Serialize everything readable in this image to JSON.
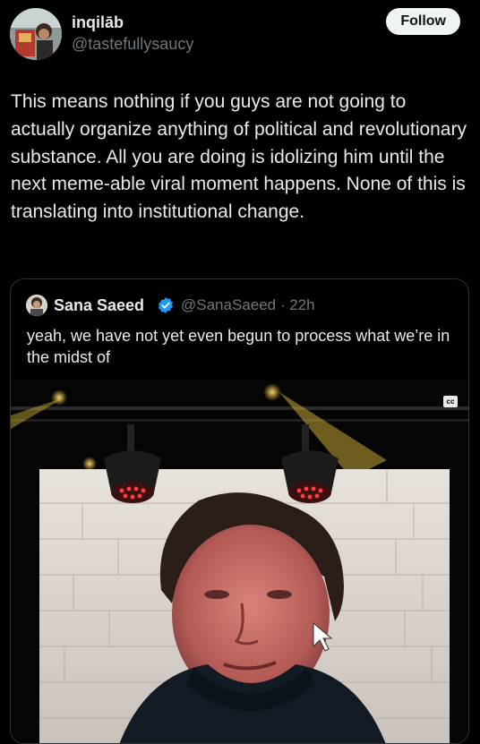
{
  "author": {
    "display_name": "inqilāb",
    "handle": "@tastefullysaucy"
  },
  "follow_label": "Follow",
  "tweet_text": "This means nothing if you guys are not going to actually organize anything of political and revolutionary substance. All you are doing is idolizing him until the next meme-able viral moment happens. None of this is translating into institutional change.",
  "quoted_tweet": {
    "display_name": "Sana Saeed",
    "handle_time": "@SanaSaeed · 22h",
    "text": "yeah, we have not yet even begun to process what we’re in the midst of",
    "media": {
      "caption_badge": "cc"
    }
  },
  "colors": {
    "background": "#000000",
    "text_primary": "#e7e9ea",
    "text_secondary": "#71767b",
    "border": "#2f3336",
    "verified_blue": "#1d9bf0",
    "follow_button_bg": "#eff3f4"
  },
  "icons": {
    "verified": "verified-badge-icon",
    "captions": "closed-captions-icon"
  }
}
